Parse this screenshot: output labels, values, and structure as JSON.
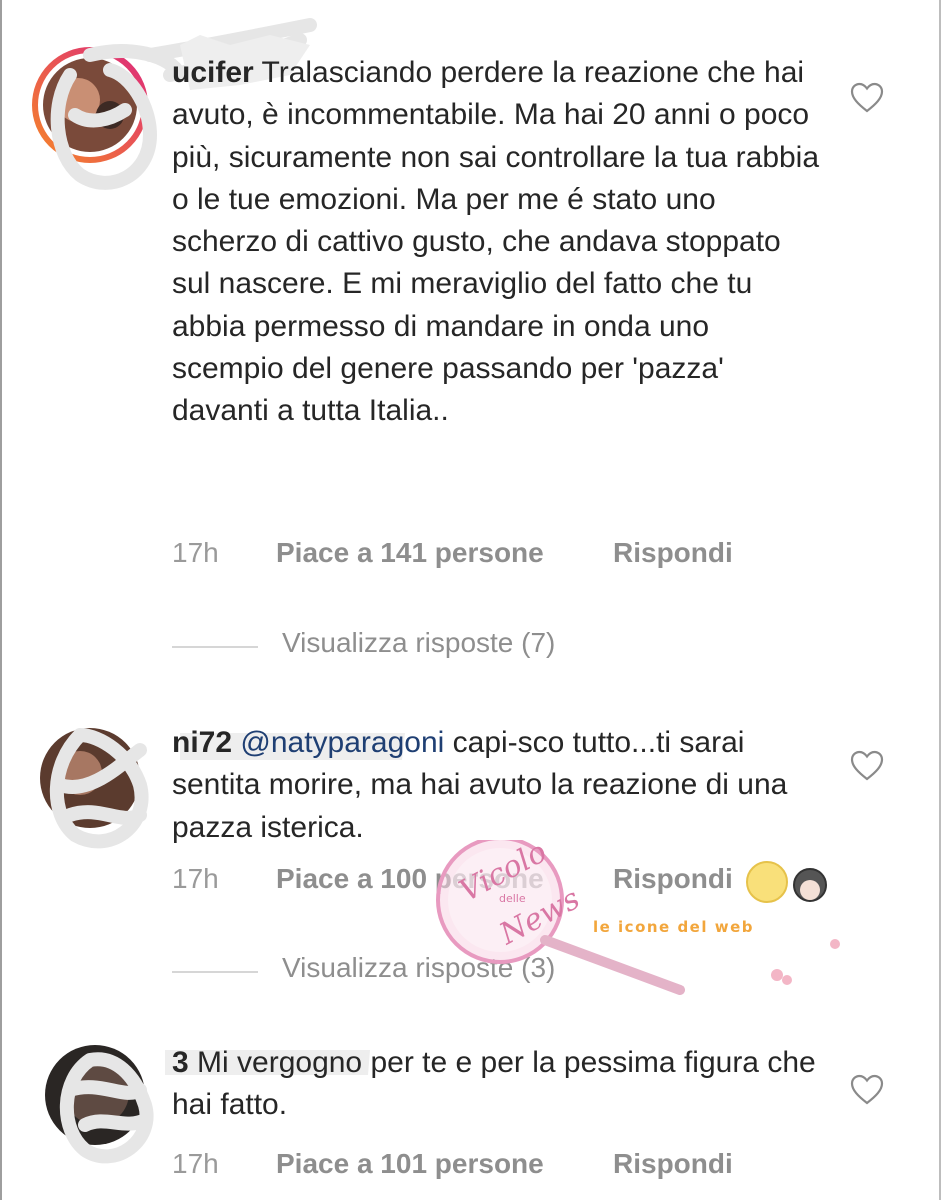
{
  "comments": [
    {
      "username": "ucifer",
      "mention": "",
      "text": "Tralasciando perdere la reazione che hai avuto, è incommentabile. Ma hai 20 anni o poco più, sicuramente non sai controllare la tua rabbia o le tue emozioni. Ma per me é stato uno scherzo di cattivo gusto, che andava stoppato sul nascere. E mi meraviglio del fatto che tu abbia permesso di mandare in onda uno scempio del genere passando per 'pazza' davanti a tutta Italia..",
      "time": "17h",
      "likes": "Piace a 141 persone",
      "reply": "Rispondi",
      "view_replies": "Visualizza risposte (7)"
    },
    {
      "username": "ni72",
      "mention": "@natyparagoni",
      "text": "capi-sco tutto...ti sarai sentita morire, ma hai avuto la reazione di una pazza isterica.",
      "time": "17h",
      "likes": "Piace a 100 persone",
      "reply": "Rispondi",
      "view_replies": "Visualizza risposte (3)"
    },
    {
      "username": "3",
      "mention": "",
      "text": "Mi vergogno per te e per la pessima figura che hai fatto.",
      "time": "17h",
      "likes": "Piace a 101 persone",
      "reply": "Rispondi"
    }
  ],
  "icons": {
    "like": "heart-outline-icon"
  },
  "watermark": {
    "logo_text_1": "Vicolo",
    "logo_text_2": "delle",
    "logo_text_3": "News",
    "banner_text": "le icone del web"
  },
  "colors": {
    "text": "#262626",
    "meta": "#8e8e8e",
    "mention": "#1f3f73",
    "story_ring_start": "#f58529",
    "story_ring_end": "#dd2a7b"
  }
}
